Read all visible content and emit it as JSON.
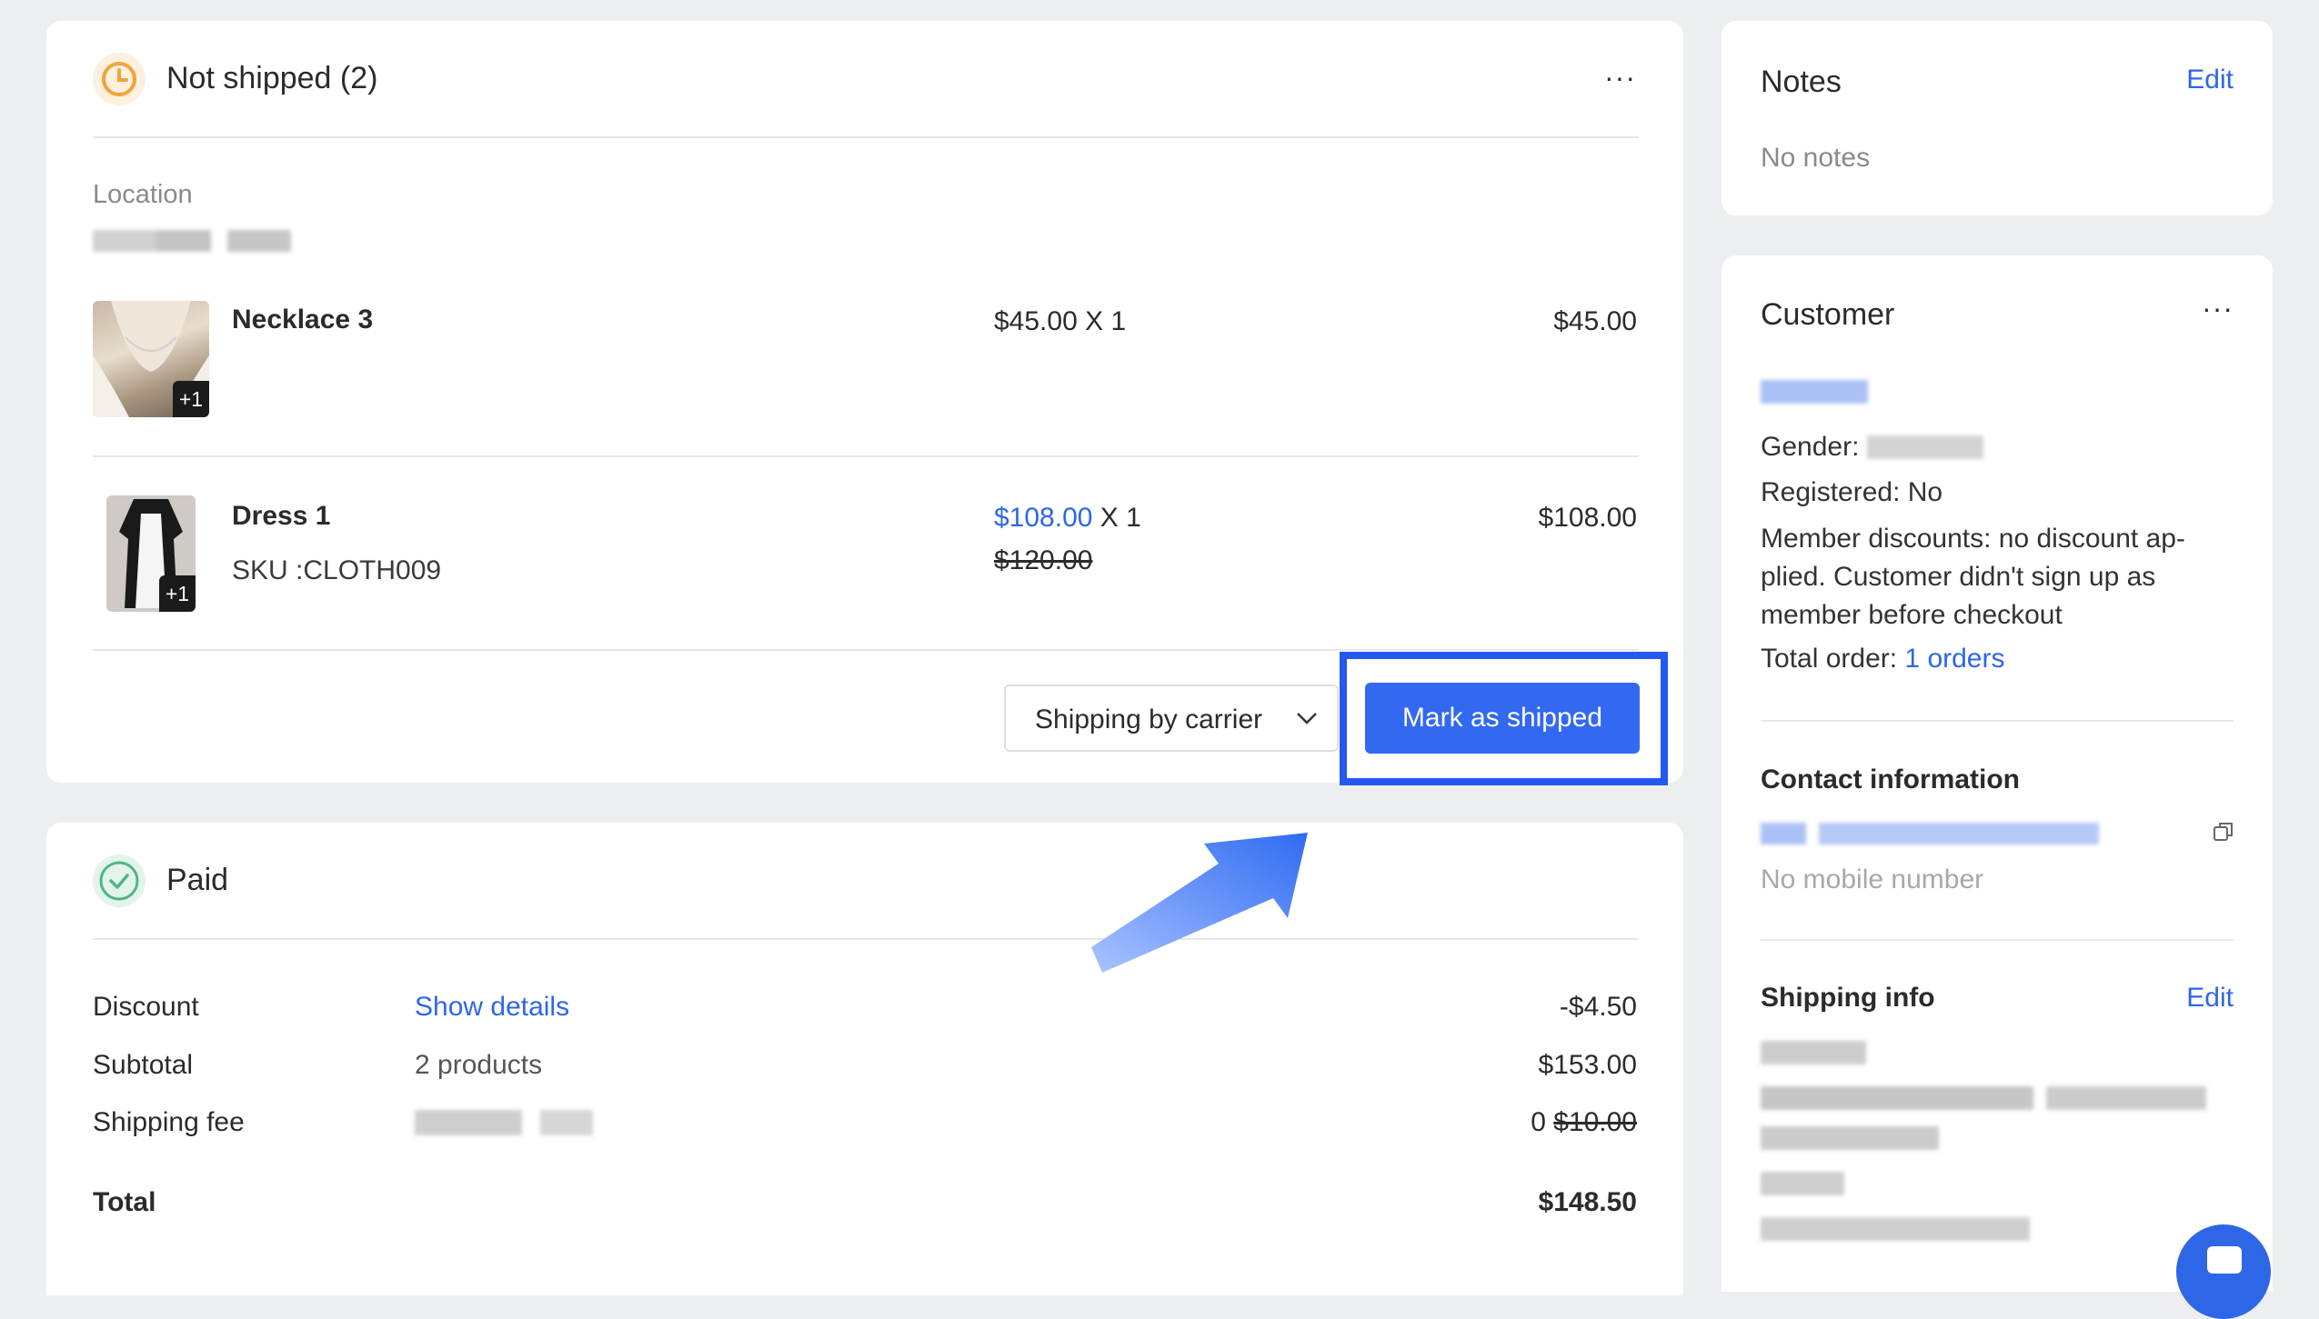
{
  "not_shipped": {
    "title": "Not shipped (2)",
    "more": "···",
    "location_label": "Location",
    "items": [
      {
        "name": "Necklace 3",
        "badge": "+1",
        "unit_price": "$45.00",
        "qty": "X 1",
        "total": "$45.00"
      },
      {
        "name": "Dress 1",
        "sku": "SKU :CLOTH009",
        "badge": "+1",
        "unit_price": "$108.00",
        "qty": "X 1",
        "original_price": "$120.00",
        "total": "$108.00"
      }
    ],
    "shipping_select": "Shipping by carrier",
    "mark_button": "Mark as shipped"
  },
  "paid": {
    "title": "Paid",
    "rows": [
      {
        "label": "Discount",
        "detail": "Show details",
        "value": "-$4.50"
      },
      {
        "label": "Subtotal",
        "detail": "2 products",
        "value": "$153.00"
      },
      {
        "label": "Shipping fee",
        "value_prefix": "0",
        "value_strike": "$10.00"
      }
    ],
    "total_label": "Total",
    "total_value": "$148.50"
  },
  "notes": {
    "title": "Notes",
    "edit": "Edit",
    "empty": "No notes"
  },
  "customer": {
    "title": "Customer",
    "more": "···",
    "gender_label": "Gender:",
    "registered": "Registered: No",
    "member_discount": "Member discounts: no discount ap-\nplied. Customer didn't sign up as\nmember before checkout",
    "total_order_label": "Total order:",
    "total_order_link": "1 orders",
    "contact_title": "Contact information",
    "no_mobile": "No mobile number",
    "shipping_title": "Shipping info",
    "shipping_edit": "Edit"
  },
  "colors": {
    "accent": "#2e66e8",
    "primary_button": "#3369f0",
    "highlight_border": "#2458f0",
    "pending_icon": "#f2a33a",
    "paid_icon": "#4fb58a",
    "background": "#eceef1"
  }
}
